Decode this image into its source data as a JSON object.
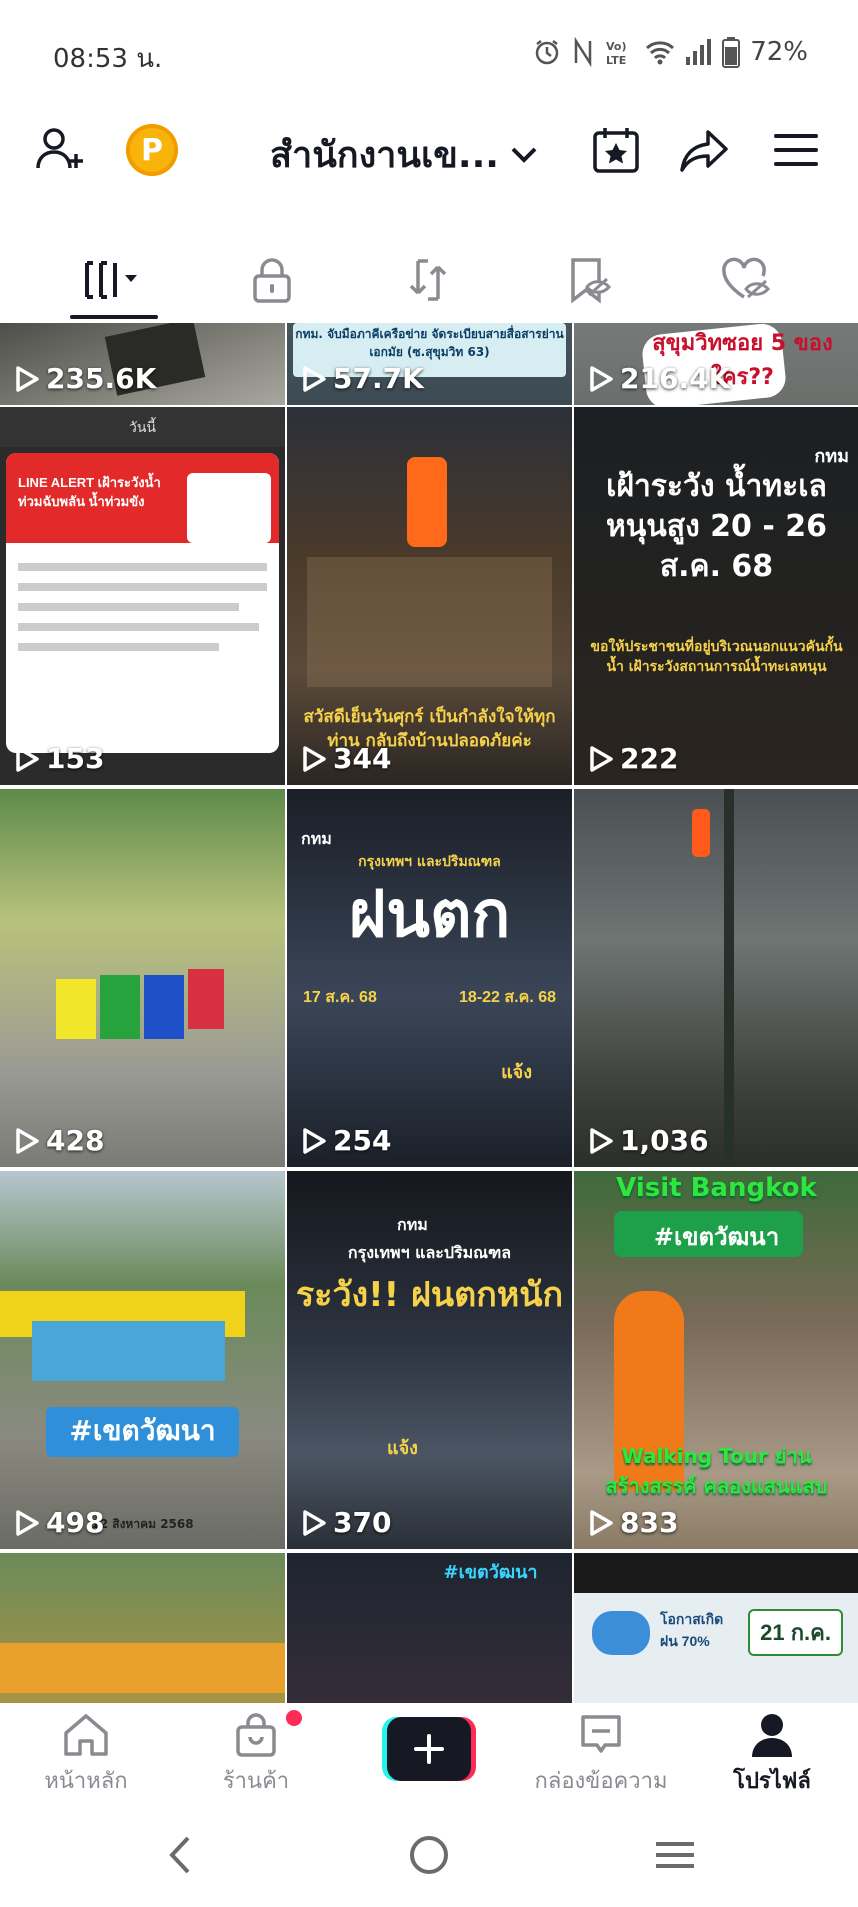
{
  "status_bar": {
    "time": "08:53 น.",
    "battery": "72%"
  },
  "top_bar": {
    "account_name": "สำนักงานเข...",
    "coin_letter": "P"
  },
  "tabs": [
    {
      "name": "videos",
      "icon": "grid-icon",
      "active": true
    },
    {
      "name": "private",
      "icon": "lock-icon"
    },
    {
      "name": "reposts",
      "icon": "repost-icon"
    },
    {
      "name": "saved",
      "icon": "bookmark-hidden-icon"
    },
    {
      "name": "liked",
      "icon": "heart-hidden-icon"
    }
  ],
  "videos": [
    {
      "views": "235.6K",
      "overlay": ""
    },
    {
      "views": "57.7K",
      "overlay": "กทม. จับมือภาคีเครือข่าย จัดระเบียบสายสื่อสารย่านเอกมัย (ซ.สุขุมวิท 63)"
    },
    {
      "views": "216.4K",
      "overlay": "สุขุมวิทซอย 5 ของใคร??"
    },
    {
      "views": "153",
      "overlay": "LINE ALERT เฝ้าระวังน้ำท่วมฉับพลัน น้ำท่วมขัง",
      "header": "วันนี้"
    },
    {
      "views": "344",
      "overlay": "สวัสดีเย็นวันศุกร์ เป็นกำลังใจให้ทุกท่าน กลับถึงบ้านปลอดภัยค่ะ"
    },
    {
      "views": "222",
      "overlay": "เฝ้าระวัง น้ำทะเลหนุนสูง 20 - 26 ส.ค. 68",
      "sub": "ขอให้ประชาชนที่อยู่บริเวณนอกแนวคันกั้นน้ำ เฝ้าระวังสถานการณ์น้ำทะเลหนุน",
      "badge": "กทม"
    },
    {
      "views": "428",
      "overlay": ""
    },
    {
      "views": "254",
      "overlay": "ฝนตก",
      "sub": "กรุงเทพฯ และปริมณฑล",
      "left_date": "17 ส.ค. 68",
      "right_date": "18-22 ส.ค. 68",
      "badge": "กทม",
      "tag": "แจ้ง"
    },
    {
      "views": "1,036",
      "overlay": ""
    },
    {
      "views": "498",
      "overlay": "#เขตวัฒนา",
      "caption": "12 สิงหาคม 2568"
    },
    {
      "views": "370",
      "overlay": "ระวัง!! ฝนตกหนัก",
      "sub": "กรุงเทพฯ และปริมณฑล",
      "badge": "กทม",
      "tag": "แจ้ง"
    },
    {
      "views": "833",
      "overlay": "Visit Bangkok",
      "tag": "#เขตวัฒนา",
      "sub": "Walking Tour ย่านสร้างสรรค์ คลองแสนแสบ"
    },
    {
      "views": "",
      "overlay": ""
    },
    {
      "views": "",
      "overlay": "#เขตวัฒนา"
    },
    {
      "views": "",
      "overlay": "21 ก.ค.",
      "sub": "โอกาสเกิดฝน 70%"
    }
  ],
  "bottom_nav": {
    "home": "หน้าหลัก",
    "shop": "ร้านค้า",
    "inbox": "กล่องข้อความ",
    "profile": "โปรไฟล์"
  },
  "colors": {
    "accent_red": "#fe2c55",
    "accent_cyan": "#25f4ee",
    "text_dark": "#161823",
    "coin": "#f8b40a"
  }
}
